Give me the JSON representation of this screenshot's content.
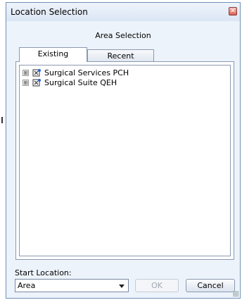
{
  "window": {
    "title": "Location Selection"
  },
  "header": {
    "label": "Area Selection"
  },
  "tabs": [
    {
      "label": "Existing",
      "selected": true
    },
    {
      "label": "Recent",
      "selected": false
    }
  ],
  "tree": {
    "items": [
      {
        "label": "Surgical Services PCH",
        "expander": "⊞",
        "icon": "location-icon"
      },
      {
        "label": "Surgical Suite QEH",
        "expander": "⊞",
        "icon": "location-icon"
      }
    ]
  },
  "footer": {
    "start_location_label": "Start Location:",
    "start_location_value": "Area",
    "ok_label": "OK",
    "cancel_label": "Cancel"
  },
  "colors": {
    "accent_border": "#6f8fb8",
    "panel_bg": "#edf3fb"
  }
}
